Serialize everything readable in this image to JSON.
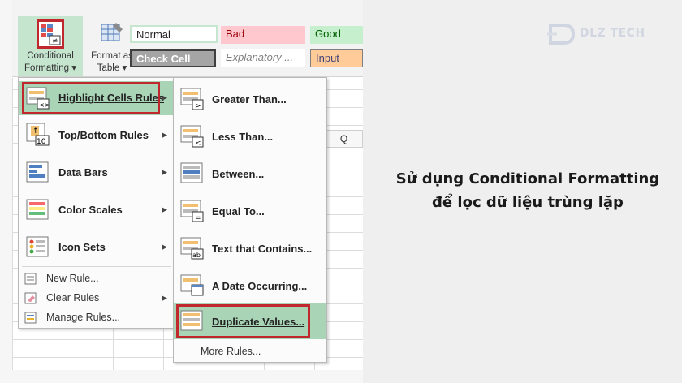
{
  "ribbon": {
    "conditional_formatting": "Conditional\nFormatting ▾",
    "format_as_table": "Format as\nTable ▾",
    "cell_styles": [
      {
        "label": "Normal",
        "bg": "#ffffff",
        "fg": "#222222"
      },
      {
        "label": "Bad",
        "bg": "#ffc7ce",
        "fg": "#9c0006"
      },
      {
        "label": "Good",
        "bg": "#c6efce",
        "fg": "#006100"
      },
      {
        "label": "Check Cell",
        "bg": "#a5a5a5",
        "fg": "#ffffff"
      },
      {
        "label": "Explanatory ...",
        "bg": "#ffffff",
        "fg": "#7f7f7f"
      },
      {
        "label": "Input",
        "bg": "#ffcc99",
        "fg": "#3f3f76"
      }
    ]
  },
  "sheet": {
    "column_header": "Q"
  },
  "menu_main": {
    "items": [
      {
        "label": "Highlight Cells Rules"
      },
      {
        "label": "Top/Bottom Rules",
        "icon_text": "10"
      },
      {
        "label": "Data Bars"
      },
      {
        "label": "Color Scales"
      },
      {
        "label": "Icon Sets"
      },
      {
        "label": "New Rule..."
      },
      {
        "label": "Clear Rules"
      },
      {
        "label": "Manage Rules..."
      }
    ]
  },
  "menu_sub": {
    "items": [
      {
        "label": "Greater Than...",
        "icon_text": ">"
      },
      {
        "label": "Less Than...",
        "icon_text": "<"
      },
      {
        "label": "Between..."
      },
      {
        "label": "Equal To...",
        "icon_text": "="
      },
      {
        "label": "Text that Contains...",
        "icon_text": "ab"
      },
      {
        "label": "A Date Occurring..."
      },
      {
        "label": "Duplicate Values..."
      },
      {
        "label": "More Rules..."
      }
    ]
  },
  "logo": {
    "text": "DLZ TECH"
  },
  "caption": {
    "line1": "Sử dụng Conditional Formatting",
    "line2": "để lọc dữ liệu trùng lặp"
  },
  "colors": {
    "highlight": "#a9d5b6",
    "red_outline": "#c0282d"
  }
}
